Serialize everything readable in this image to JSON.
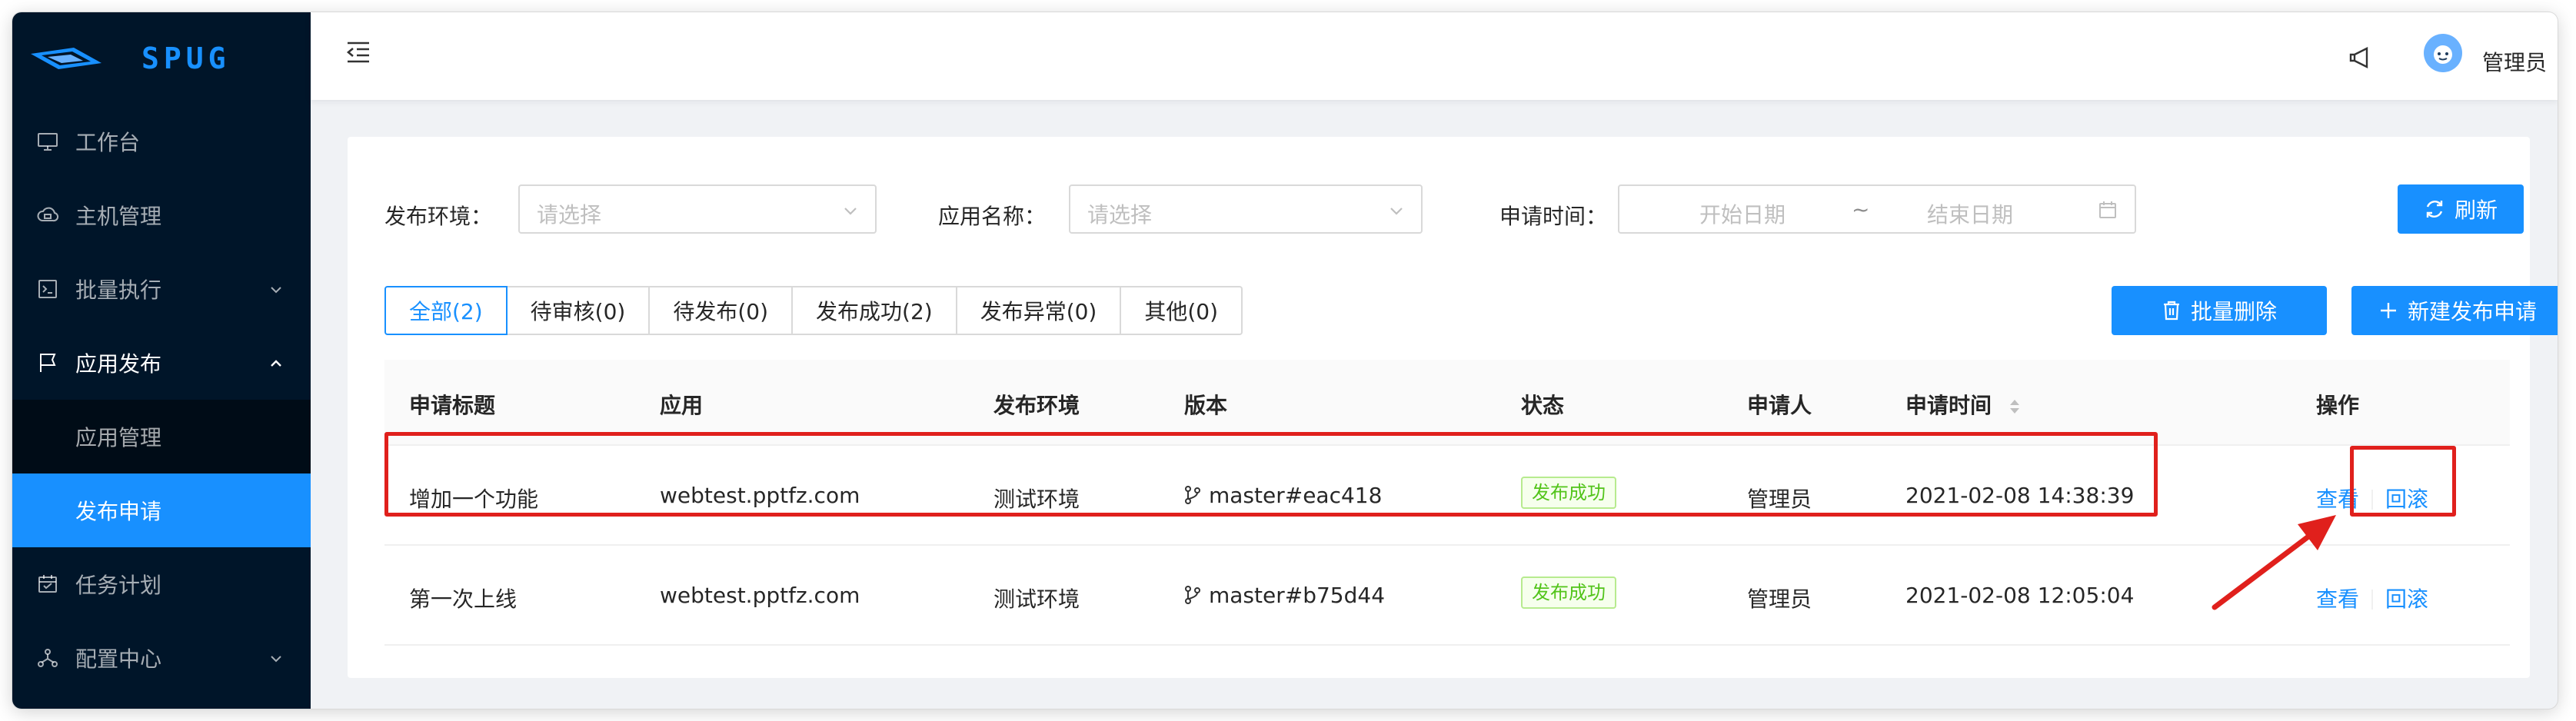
{
  "app": {
    "logo_text": "SPUG"
  },
  "sidebar": {
    "items": [
      {
        "label": "工作台",
        "icon": "desktop-icon"
      },
      {
        "label": "主机管理",
        "icon": "cloud-server-icon"
      },
      {
        "label": "批量执行",
        "icon": "code-icon",
        "has_children": true
      },
      {
        "label": "应用发布",
        "icon": "flag-icon",
        "has_children": true,
        "open": true,
        "children": [
          {
            "label": "应用管理"
          },
          {
            "label": "发布申请",
            "active": true
          }
        ]
      },
      {
        "label": "任务计划",
        "icon": "schedule-icon"
      },
      {
        "label": "配置中心",
        "icon": "deployment-icon",
        "has_children": true
      }
    ]
  },
  "header": {
    "username": "管理员"
  },
  "filters": {
    "env_label": "发布环境：",
    "env_placeholder": "请选择",
    "app_label": "应用名称：",
    "app_placeholder": "请选择",
    "time_label": "申请时间：",
    "start_placeholder": "开始日期",
    "end_placeholder": "结束日期",
    "range_separator": "~",
    "refresh_label": "刷新"
  },
  "tabs": [
    {
      "label": "全部(2)",
      "checked": true
    },
    {
      "label": "待审核(0)"
    },
    {
      "label": "待发布(0)"
    },
    {
      "label": "发布成功(2)"
    },
    {
      "label": "发布异常(0)"
    },
    {
      "label": "其他(0)"
    }
  ],
  "actions": {
    "batch_delete": "批量删除",
    "new_request": "新建发布申请"
  },
  "table": {
    "columns": [
      "申请标题",
      "应用",
      "发布环境",
      "版本",
      "状态",
      "申请人",
      "申请时间",
      "操作"
    ],
    "rows": [
      {
        "title": "增加一个功能",
        "app": "webtest.pptfz.com",
        "env": "测试环境",
        "version": "master#eac418",
        "status": "发布成功",
        "applicant": "管理员",
        "time": "2021-02-08 14:38:39",
        "view": "查看",
        "rollback": "回滚"
      },
      {
        "title": "第一次上线",
        "app": "webtest.pptfz.com",
        "env": "测试环境",
        "version": "master#b75d44",
        "status": "发布成功",
        "applicant": "管理员",
        "time": "2021-02-08 12:05:04",
        "view": "查看",
        "rollback": "回滚"
      }
    ]
  },
  "colors": {
    "primary": "#1890ff",
    "sidebar": "#001529",
    "success": "#52c41a",
    "annotation": "#e0201c"
  }
}
